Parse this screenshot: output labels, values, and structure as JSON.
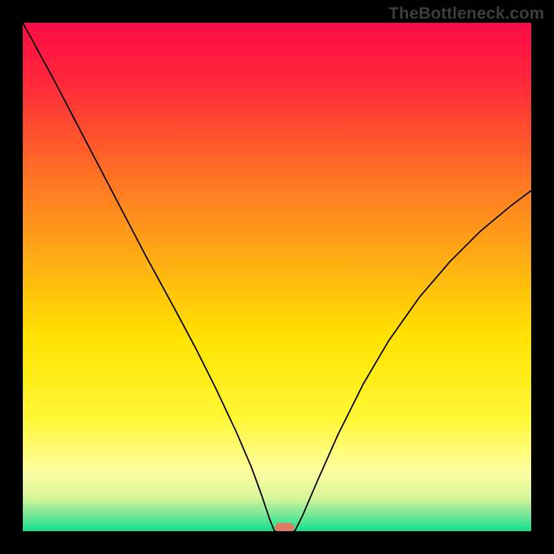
{
  "watermark": {
    "text": "TheBottleneck.com"
  },
  "chart_data": {
    "type": "line",
    "title": "",
    "xlabel": "",
    "ylabel": "",
    "xlim": [
      0,
      100
    ],
    "ylim": [
      0,
      100
    ],
    "grid": false,
    "legend": false,
    "gradient_stops": [
      {
        "pos": 0.0,
        "color": "#ff0b47"
      },
      {
        "pos": 0.12,
        "color": "#ff2a3a"
      },
      {
        "pos": 0.28,
        "color": "#ff6a27"
      },
      {
        "pos": 0.45,
        "color": "#ffa816"
      },
      {
        "pos": 0.62,
        "color": "#ffe300"
      },
      {
        "pos": 0.78,
        "color": "#fff838"
      },
      {
        "pos": 0.88,
        "color": "#fffea0"
      },
      {
        "pos": 0.935,
        "color": "#d7f59a"
      },
      {
        "pos": 0.965,
        "color": "#7fe79b"
      },
      {
        "pos": 1.0,
        "color": "#14e18c"
      }
    ],
    "series": [
      {
        "name": "bottleneck-curve",
        "points": [
          {
            "x": 0.0,
            "y": 100.0
          },
          {
            "x": 6.0,
            "y": 89.0
          },
          {
            "x": 12.0,
            "y": 77.5
          },
          {
            "x": 18.0,
            "y": 66.0
          },
          {
            "x": 24.0,
            "y": 54.5
          },
          {
            "x": 30.0,
            "y": 43.5
          },
          {
            "x": 34.0,
            "y": 36.0
          },
          {
            "x": 38.0,
            "y": 28.0
          },
          {
            "x": 42.0,
            "y": 19.5
          },
          {
            "x": 45.0,
            "y": 12.5
          },
          {
            "x": 47.0,
            "y": 7.0
          },
          {
            "x": 48.5,
            "y": 2.5
          },
          {
            "x": 49.5,
            "y": 0.0
          },
          {
            "x": 53.5,
            "y": 0.0
          },
          {
            "x": 55.0,
            "y": 3.0
          },
          {
            "x": 58.0,
            "y": 10.0
          },
          {
            "x": 62.0,
            "y": 19.0
          },
          {
            "x": 67.0,
            "y": 29.0
          },
          {
            "x": 72.0,
            "y": 37.5
          },
          {
            "x": 78.0,
            "y": 46.0
          },
          {
            "x": 84.0,
            "y": 53.0
          },
          {
            "x": 90.0,
            "y": 59.0
          },
          {
            "x": 96.0,
            "y": 64.0
          },
          {
            "x": 100.0,
            "y": 67.0
          }
        ]
      }
    ],
    "marker": {
      "x": 51.5,
      "y": 0.0,
      "color": "#de7c68"
    }
  }
}
